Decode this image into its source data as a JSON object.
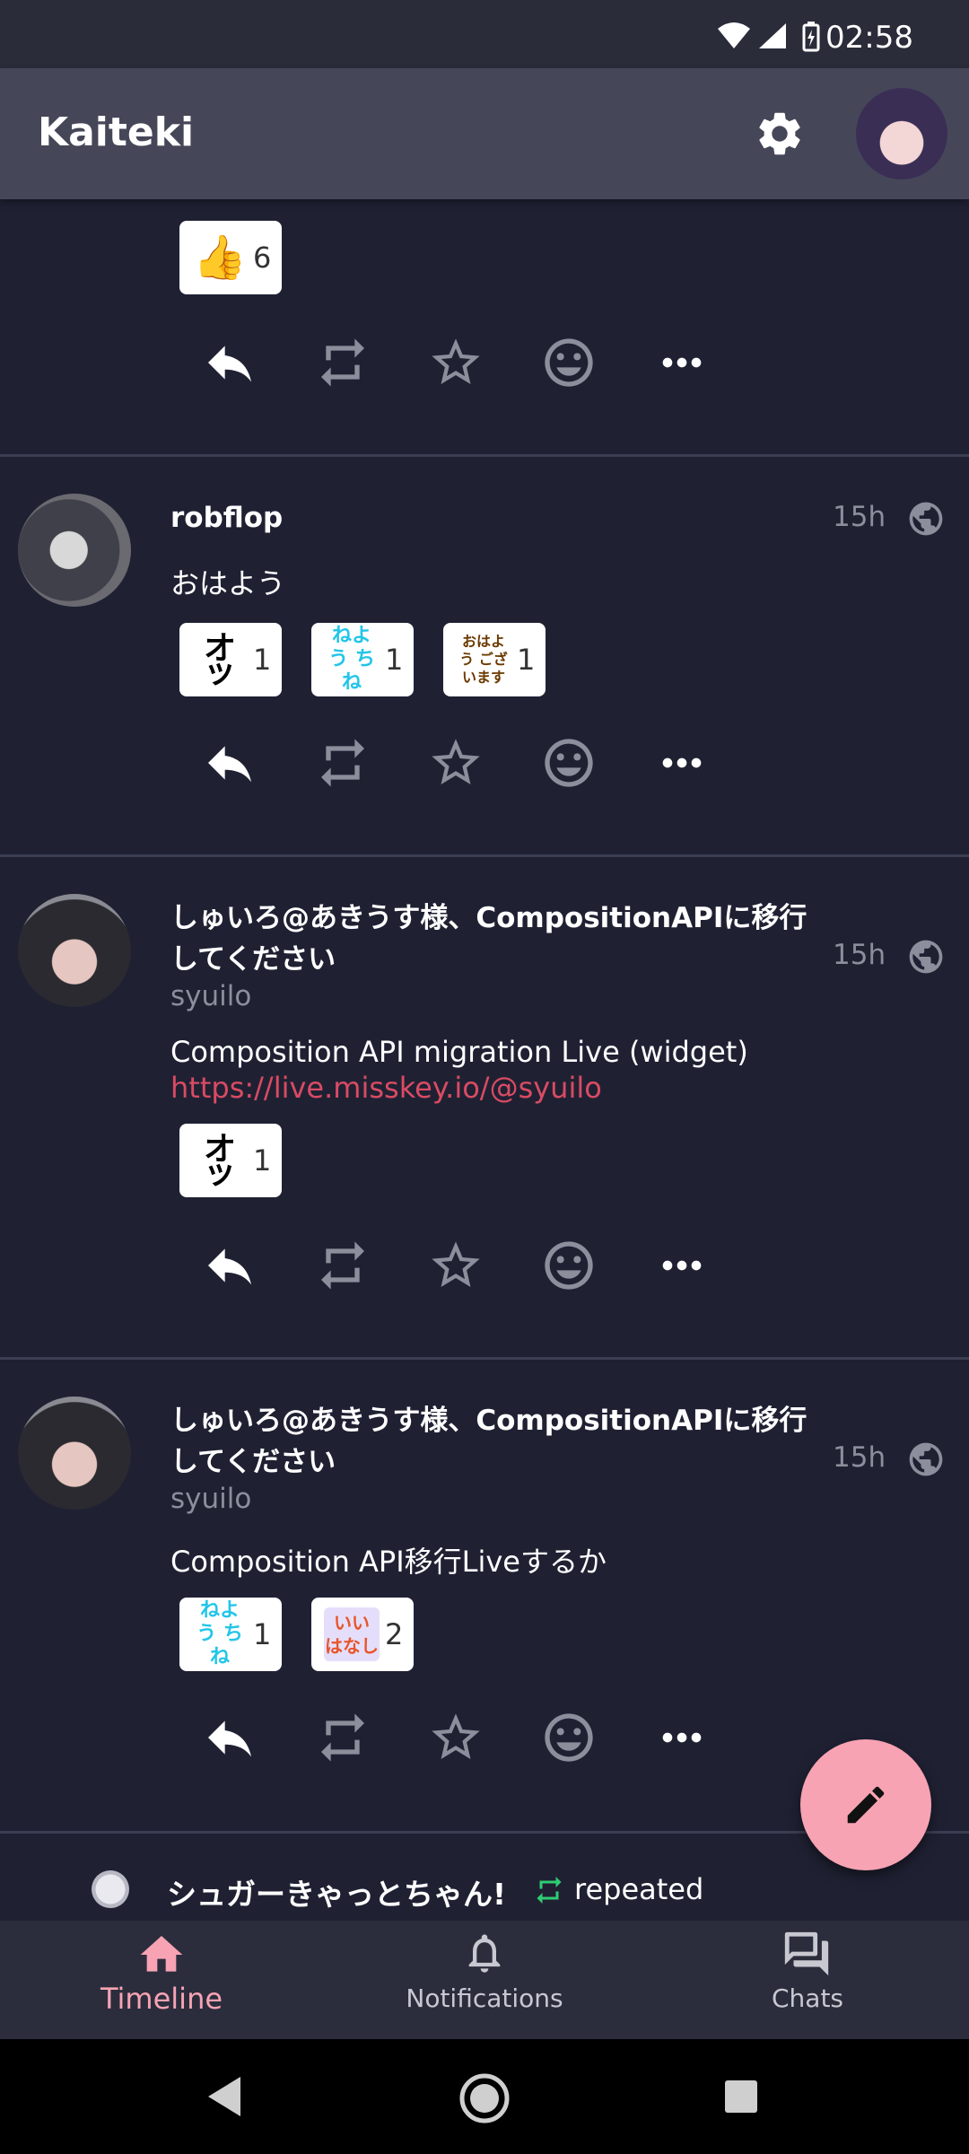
{
  "status_bar": {
    "time": "02:58",
    "icons": [
      "wifi-icon",
      "signal-icon",
      "battery-icon"
    ]
  },
  "app_bar": {
    "title": "Kaiteki",
    "icons": [
      "settings-icon",
      "account-avatar"
    ]
  },
  "colors": {
    "background": "#1f2133",
    "app_bar": "#454758",
    "accent": "#f7a3b3",
    "link": "#d94b63",
    "repeat_green": "#2ecc71"
  },
  "posts": [
    {
      "reactions": [
        {
          "emoji": "👍",
          "count": "6"
        }
      ],
      "actions": [
        "reply-icon",
        "repeat-icon",
        "favorite-icon",
        "react-icon",
        "more-icon"
      ]
    },
    {
      "name": "robflop",
      "time": "15h",
      "text": "おはよう",
      "reactions": [
        {
          "emoji": "オッ",
          "count": "1"
        },
        {
          "emoji": "ねよう ちね",
          "count": "1"
        },
        {
          "emoji": "おはよう ございます",
          "count": "1"
        }
      ]
    },
    {
      "name": "しゅいろ@あきうす様、CompositionAPIに移行してください",
      "handle": "syuilo",
      "time": "15h",
      "text": "Composition API migration Live (widget)",
      "link": "https://live.misskey.io/@syuilo",
      "reactions": [
        {
          "emoji": "オッ",
          "count": "1"
        }
      ]
    },
    {
      "name": "しゅいろ@あきうす様、CompositionAPIに移行してください",
      "handle": "syuilo",
      "time": "15h",
      "text": "Composition API移行Liveするか",
      "reactions": [
        {
          "emoji": "ねよう ちね",
          "count": "1"
        },
        {
          "emoji": "いい はなし",
          "count": "2"
        }
      ]
    }
  ],
  "repeat_notice": {
    "user": "シュガーきゃっとちゃん!",
    "label": "repeated"
  },
  "bottom_nav": [
    {
      "label": "Timeline",
      "icon": "home-icon",
      "active": true
    },
    {
      "label": "Notifications",
      "icon": "bell-icon",
      "active": false
    },
    {
      "label": "Chats",
      "icon": "chat-icon",
      "active": false
    }
  ],
  "fab": {
    "icon": "pencil-icon"
  }
}
